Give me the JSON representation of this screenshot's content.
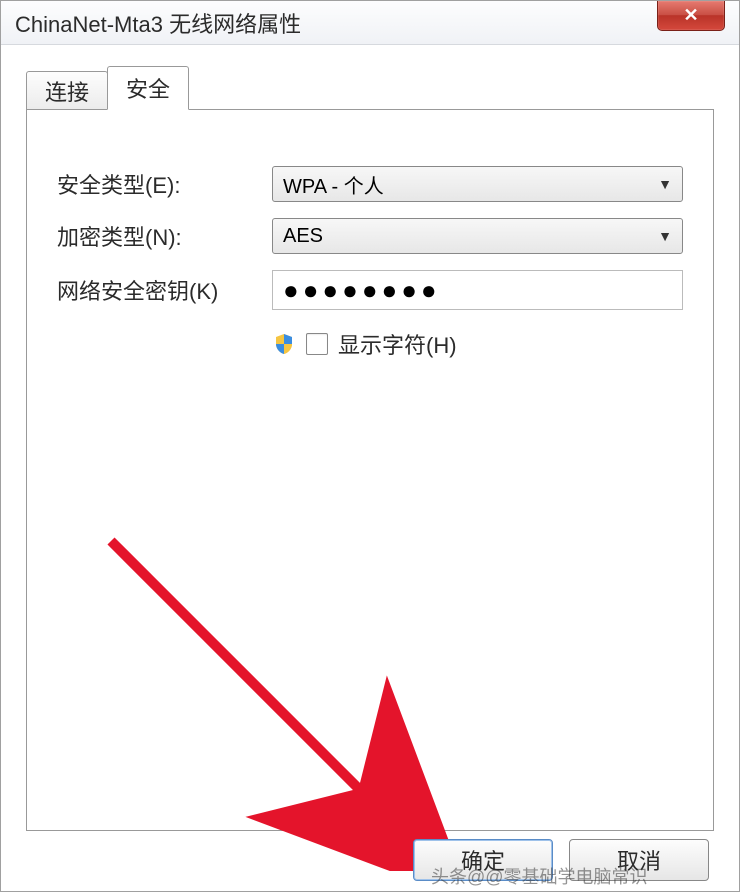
{
  "window": {
    "title": "ChinaNet-Mta3 无线网络属性"
  },
  "tabs": {
    "connect": "连接",
    "security": "安全"
  },
  "form": {
    "security_type_label": "安全类型(E):",
    "security_type_value": "WPA - 个人",
    "encryption_type_label": "加密类型(N):",
    "encryption_type_value": "AES",
    "network_key_label": "网络安全密钥(K)",
    "network_key_value": "●●●●●●●●",
    "show_chars_label": "显示字符(H)"
  },
  "buttons": {
    "ok": "确定",
    "cancel": "取消"
  },
  "watermark": "头条@@零基础学电脑常识"
}
